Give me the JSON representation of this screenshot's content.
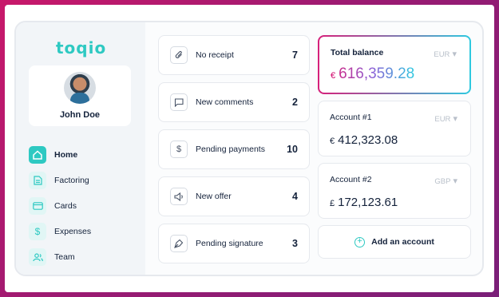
{
  "brand": {
    "logo_text": "toqio",
    "accent": "#2ec9c2"
  },
  "profile": {
    "name": "John Doe"
  },
  "sidebar": {
    "items": [
      {
        "label": "Home",
        "icon": "home-icon",
        "active": true
      },
      {
        "label": "Factoring",
        "icon": "document-icon"
      },
      {
        "label": "Cards",
        "icon": "card-icon"
      },
      {
        "label": "Expenses",
        "icon": "dollar-icon"
      },
      {
        "label": "Team",
        "icon": "team-icon"
      }
    ]
  },
  "notifications": [
    {
      "label": "No receipt",
      "count": "7",
      "icon": "paperclip-icon"
    },
    {
      "label": "New comments",
      "count": "2",
      "icon": "comment-icon"
    },
    {
      "label": "Pending payments",
      "count": "10",
      "icon": "dollar-icon"
    },
    {
      "label": "New offer",
      "count": "4",
      "icon": "megaphone-icon"
    },
    {
      "label": "Pending signature",
      "count": "3",
      "icon": "pen-icon"
    }
  ],
  "accounts": {
    "total": {
      "title": "Total balance",
      "currency": "EUR",
      "symbol": "€",
      "amount": "616,359.28"
    },
    "list": [
      {
        "title": "Account #1",
        "currency": "EUR",
        "symbol": "€",
        "amount": "412,323.08"
      },
      {
        "title": "Account #2",
        "currency": "GBP",
        "symbol": "£",
        "amount": "172,123.61"
      }
    ],
    "add_label": "Add an account"
  }
}
